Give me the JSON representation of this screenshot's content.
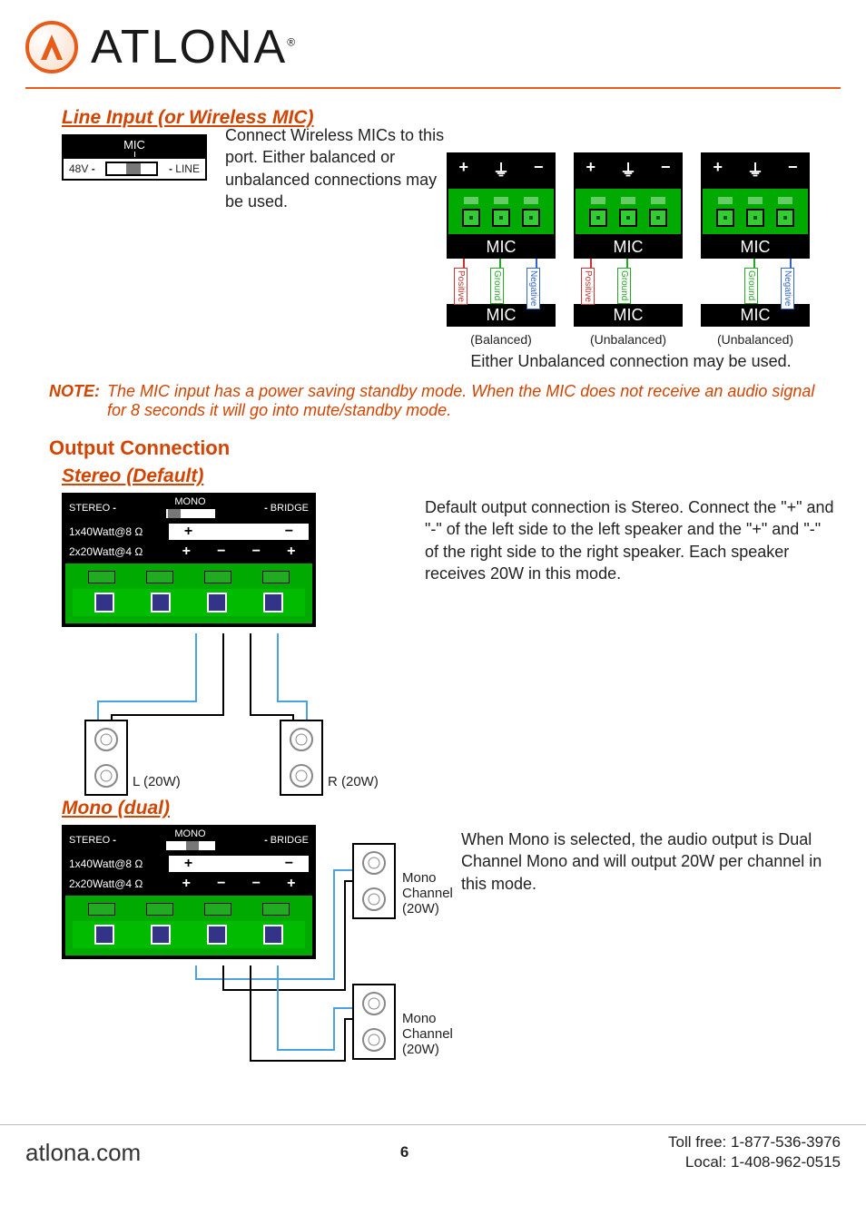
{
  "brand": {
    "name": "ATLONA",
    "reg": "®"
  },
  "line_input": {
    "heading": "Line Input (or Wireless MIC)",
    "body": "Connect Wireless MICs to this port. Either balanced or unbalanced connections may be used.",
    "switch": {
      "top": "MIC",
      "left": "48V",
      "right": "LINE"
    }
  },
  "mic_diagrams": {
    "barsyms": {
      "plus": "+",
      "gnd": "⏚",
      "minus": "−"
    },
    "lbl_upper": "MIC",
    "lbl_lower": "MIC",
    "tags": {
      "pos": "Positive",
      "gnd": "Ground",
      "neg": "Negative"
    },
    "captions": [
      "(Balanced)",
      "(Unbalanced)",
      "(Unbalanced)"
    ],
    "footnote": "Either Unbalanced connection may be used."
  },
  "note": {
    "label": "NOTE:",
    "text": "The MIC input has a power saving standby mode. When the MIC does not receive an audio signal for 8 seconds it will go into mute/standby mode."
  },
  "output": {
    "heading": "Output Connection",
    "stereo": {
      "sub": "Stereo (Default)",
      "body": "Default output connection is Stereo. Connect the \"+\" and \"-\" of the left side to the left speaker and the \"+\" and \"-\" of the right side to the right speaker. Each speaker receives 20W in this mode.",
      "amp": {
        "top": "MONO",
        "left": "STEREO",
        "right": "BRIDGE",
        "row1": {
          "label": "1x40Watt@8 Ω",
          "syms": [
            "+",
            "",
            "",
            "−"
          ]
        },
        "row2": {
          "label": "2x20Watt@4 Ω",
          "syms": [
            "+",
            "−",
            "−",
            "+"
          ]
        }
      },
      "left_speaker": "L (20W)",
      "right_speaker": "R (20W)"
    },
    "mono": {
      "sub": "Mono (dual)",
      "body": "When Mono is selected, the audio output is Dual Channel Mono and will output 20W per channel in this mode.",
      "amp": {
        "top": "MONO",
        "left": "STEREO",
        "right": "BRIDGE",
        "row1": {
          "label": "1x40Watt@8 Ω",
          "syms": [
            "+",
            "",
            "",
            "−"
          ]
        },
        "row2": {
          "label": "2x20Watt@4 Ω",
          "syms": [
            "+",
            "−",
            "−",
            "+"
          ]
        }
      },
      "sp1": "Mono\nChannel\n(20W)",
      "sp2": "Mono\nChannel\n(20W)"
    }
  },
  "footer": {
    "site": "atlona.com",
    "page": "6",
    "tollfree": "Toll free: 1-877-536-3976",
    "local": "Local: 1-408-962-0515"
  }
}
